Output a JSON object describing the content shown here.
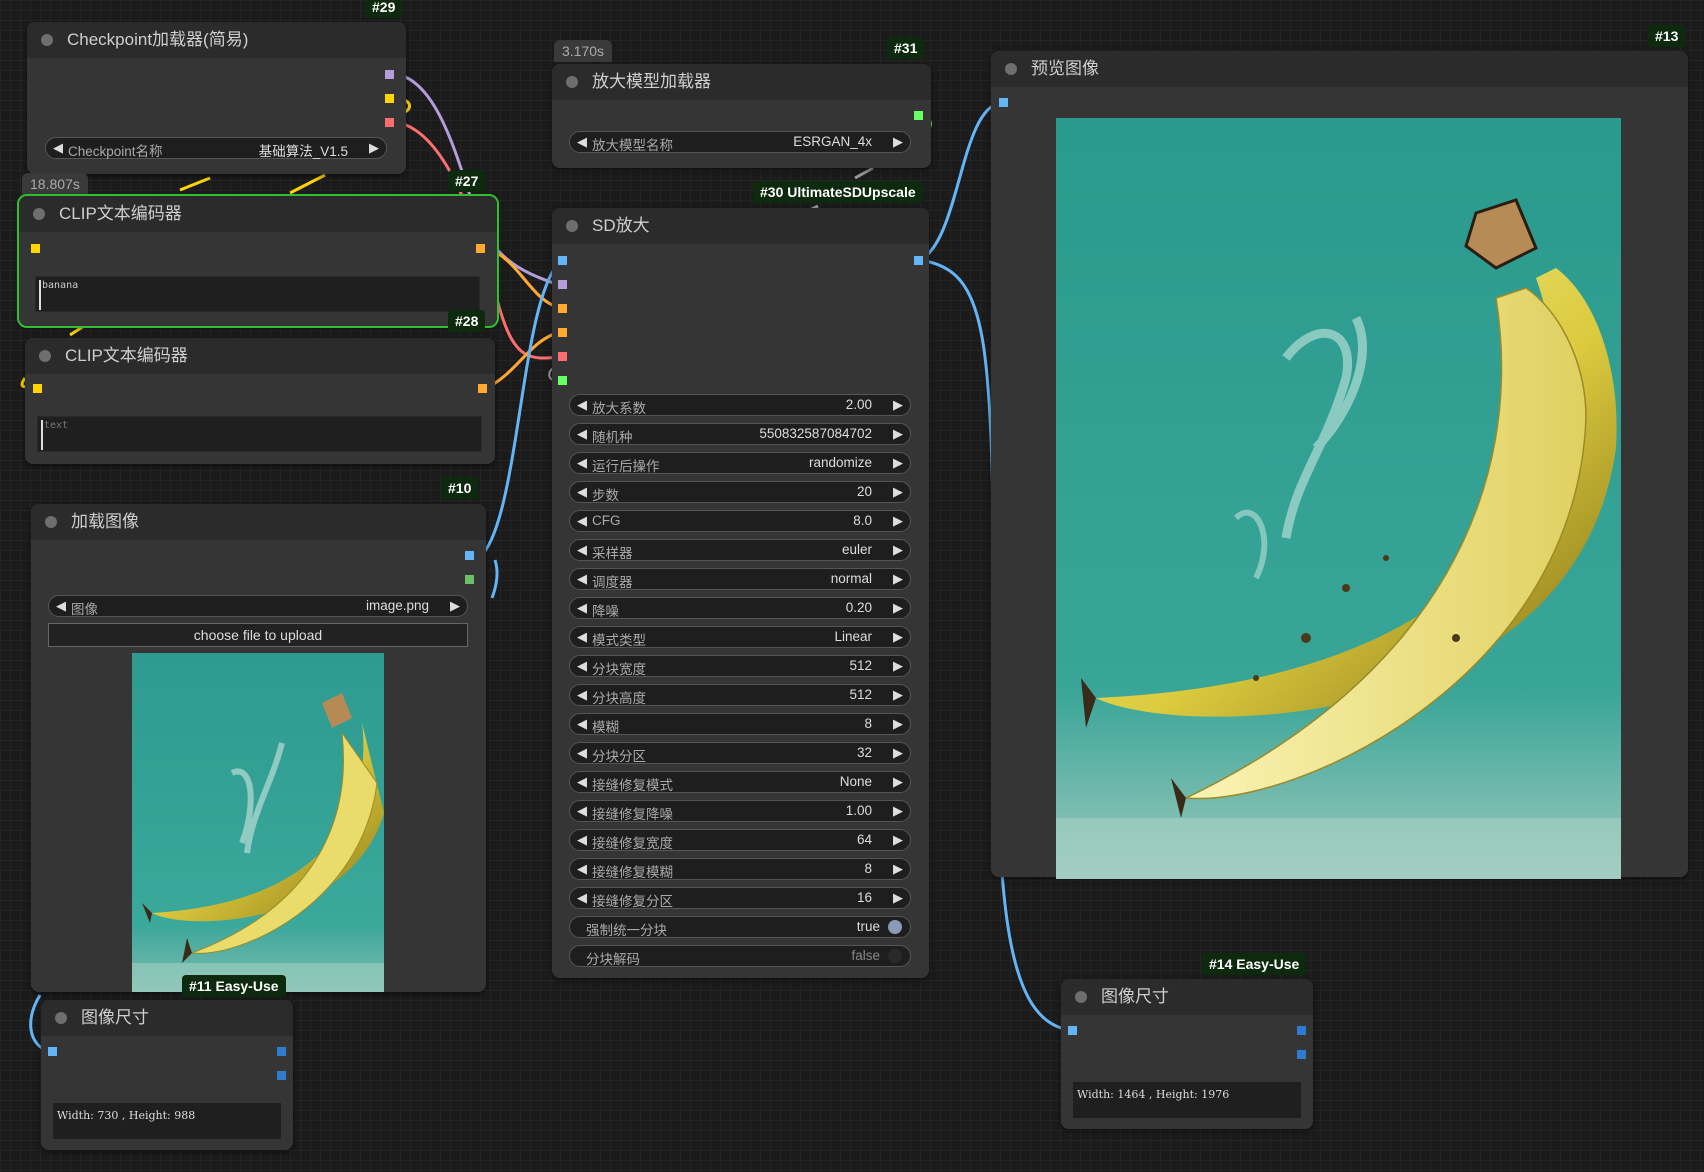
{
  "nodes": {
    "checkpoint": {
      "badge": "#29",
      "title": "Checkpoint加载器(简易)",
      "widget_label": "Checkpoint名称",
      "widget_value": "基础算法_V1.5"
    },
    "clip1": {
      "badge": "#27",
      "time": "18.807s",
      "title": "CLIP文本编码器",
      "text": "banana"
    },
    "clip2": {
      "badge": "#28",
      "title": "CLIP文本编码器",
      "text_placeholder": "text"
    },
    "load_image": {
      "badge": "#10",
      "title": "加载图像",
      "widget_label": "图像",
      "widget_value": "image.png",
      "upload_label": "choose file to upload"
    },
    "image_size_left": {
      "badge": "#11 Easy-Use",
      "title": "图像尺寸",
      "info": "Width: 730 , Height: 988"
    },
    "upscale_loader": {
      "badge": "#31",
      "time": "3.170s",
      "title": "放大模型加载器",
      "widget_label": "放大模型名称",
      "widget_value": "ESRGAN_4x"
    },
    "sd_upscale": {
      "badge": "#30 UltimateSDUpscale",
      "title": "SD放大",
      "widgets": [
        {
          "label": "放大系数",
          "value": "2.00"
        },
        {
          "label": "随机种",
          "value": "550832587084702"
        },
        {
          "label": "运行后操作",
          "value": "randomize"
        },
        {
          "label": "步数",
          "value": "20"
        },
        {
          "label": "CFG",
          "value": "8.0"
        },
        {
          "label": "采样器",
          "value": "euler"
        },
        {
          "label": "调度器",
          "value": "normal"
        },
        {
          "label": "降噪",
          "value": "0.20"
        },
        {
          "label": "模式类型",
          "value": "Linear"
        },
        {
          "label": "分块宽度",
          "value": "512"
        },
        {
          "label": "分块高度",
          "value": "512"
        },
        {
          "label": "模糊",
          "value": "8"
        },
        {
          "label": "分块分区",
          "value": "32"
        },
        {
          "label": "接缝修复模式",
          "value": "None"
        },
        {
          "label": "接缝修复降噪",
          "value": "1.00"
        },
        {
          "label": "接缝修复宽度",
          "value": "64"
        },
        {
          "label": "接缝修复模糊",
          "value": "8"
        },
        {
          "label": "接缝修复分区",
          "value": "16"
        }
      ],
      "toggles": [
        {
          "label": "强制统一分块",
          "value": "true"
        },
        {
          "label": "分块解码",
          "value": "false"
        }
      ]
    },
    "preview": {
      "badge": "#13",
      "title": "预览图像"
    },
    "image_size_right": {
      "badge": "#14 Easy-Use",
      "title": "图像尺寸",
      "info": "Width: 1464 , Height: 1976"
    }
  },
  "colors": {
    "model_port": "#b39ddb",
    "clip_port": "#ffd500",
    "vae_port": "#ff6e6e",
    "conditioning_port": "#ffa931",
    "image_port": "#64b5f6",
    "upscale_model_port": "#66ff66",
    "int_port": "#2e7bd1",
    "selected_outline": "#2ec02e",
    "badge_bg": "#0e2a0e"
  }
}
